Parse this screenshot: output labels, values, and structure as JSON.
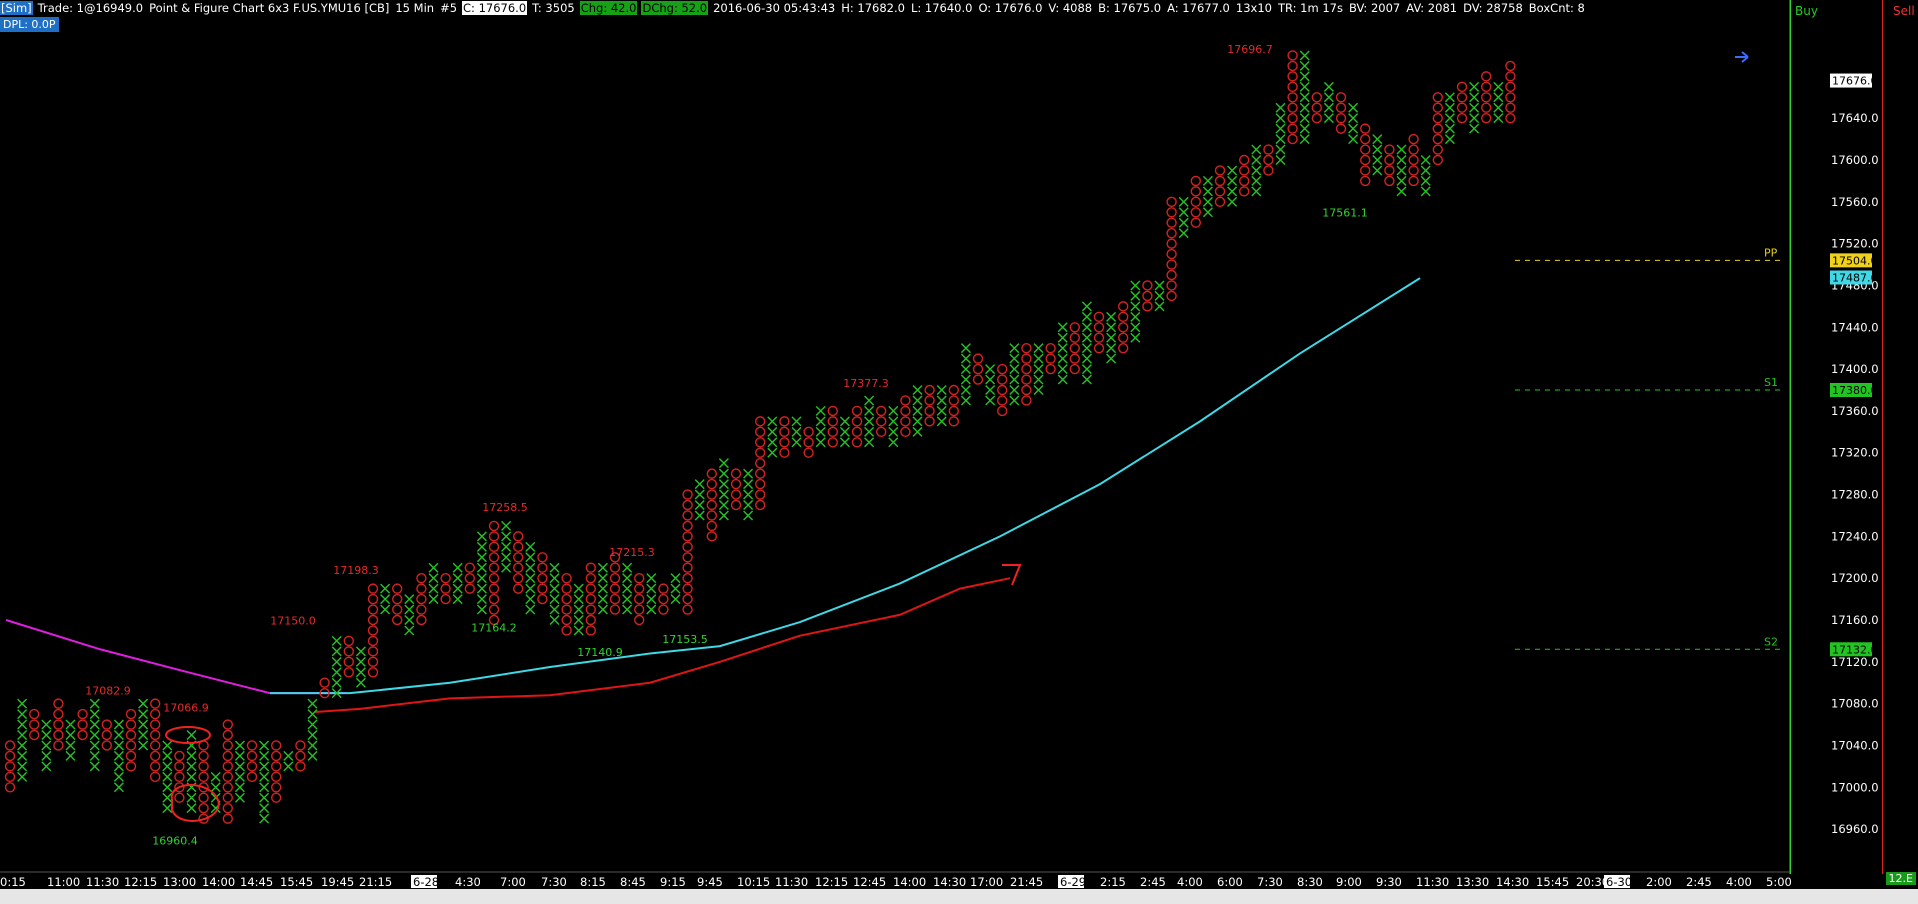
{
  "header": {
    "sim": "[Sim]",
    "trade": "Trade: 1@16949.0",
    "title": "Point & Figure Chart 6x3 F.US.YMU16 [CB]",
    "interval": "15 Min",
    "count": "#5",
    "close": "C: 17676.0",
    "ticks": "T: 3505",
    "chg": "Chg: 42.0",
    "dchg": "DChg: 52.0",
    "timestamp": "2016-06-30 05:43:43",
    "high": "H: 17682.0",
    "low": "L: 17640.0",
    "open": "O: 17676.0",
    "volume": "V: 4088",
    "bid": "B: 17675.0",
    "ask": "A: 17677.0",
    "size": "13x10",
    "tr": "TR: 1m 17s",
    "bv": "BV: 2007",
    "av": "AV: 2081",
    "dv": "DV: 28758",
    "boxcnt": "BoxCnt: 8"
  },
  "dpl": "DPL: 0.0P",
  "panels": {
    "buy": "Buy",
    "sell": "Sell",
    "corner_price": "12.E"
  },
  "colors": {
    "x_color": "#27c227",
    "o_color": "#d52222",
    "ma_cyan": "#3fd8e6",
    "ma_magenta": "#e01ee0",
    "pp_yellow": "#e6d019",
    "level_green": "#22c422"
  },
  "chart_data": {
    "type": "point-and-figure",
    "ylim": [
      16940,
      17710
    ],
    "y_ticks": [
      16960,
      17000,
      17040,
      17080,
      17120,
      17160,
      17200,
      17240,
      17280,
      17320,
      17360,
      17400,
      17440,
      17480,
      17520,
      17560,
      17600,
      17640
    ],
    "x_tick_labels": [
      "0:15",
      "11:00",
      "11:30",
      "12:15",
      "13:00",
      "14:00",
      "14:45",
      "15:45",
      "19:45",
      "21:15",
      "6-28",
      "4:30",
      "7:00",
      "7:30",
      "8:15",
      "8:45",
      "9:15",
      "9:45",
      "10:15",
      "11:30",
      "12:15",
      "12:45",
      "14:00",
      "14:30",
      "17:00",
      "21:45",
      "6-29",
      "2:15",
      "2:45",
      "4:00",
      "6:00",
      "7:30",
      "8:30",
      "9:00",
      "9:30",
      "11:30",
      "13:30",
      "14:30",
      "15:45",
      "20:30",
      "6-30",
      "2:00",
      "2:45",
      "4:00",
      "5:00"
    ],
    "column_ranges": [
      [
        17000,
        17040
      ],
      [
        17010,
        17080
      ],
      [
        17050,
        17070
      ],
      [
        17020,
        17060
      ],
      [
        17040,
        17080
      ],
      [
        17030,
        17060
      ],
      [
        17050,
        17070
      ],
      [
        17020,
        17080
      ],
      [
        17040,
        17060
      ],
      [
        17000,
        17060
      ],
      [
        17020,
        17070
      ],
      [
        17040,
        17080
      ],
      [
        17010,
        17080
      ],
      [
        16980,
        17040
      ],
      [
        16990,
        17030
      ],
      [
        16980,
        17050
      ],
      [
        16970,
        17040
      ],
      [
        16980,
        17010
      ],
      [
        16970,
        17060
      ],
      [
        16990,
        17040
      ],
      [
        17010,
        17040
      ],
      [
        16970,
        17040
      ],
      [
        16990,
        17040
      ],
      [
        17020,
        17030
      ],
      [
        17020,
        17040
      ],
      [
        17030,
        17080
      ],
      [
        17090,
        17100
      ],
      [
        17090,
        17140
      ],
      [
        17110,
        17140
      ],
      [
        17100,
        17130
      ],
      [
        17110,
        17190
      ],
      [
        17170,
        17190
      ],
      [
        17160,
        17190
      ],
      [
        17150,
        17180
      ],
      [
        17160,
        17200
      ],
      [
        17180,
        17210
      ],
      [
        17180,
        17200
      ],
      [
        17180,
        17210
      ],
      [
        17190,
        17210
      ],
      [
        17170,
        17240
      ],
      [
        17160,
        17250
      ],
      [
        17210,
        17250
      ],
      [
        17190,
        17240
      ],
      [
        17170,
        17230
      ],
      [
        17180,
        17220
      ],
      [
        17160,
        17210
      ],
      [
        17150,
        17200
      ],
      [
        17150,
        17190
      ],
      [
        17150,
        17210
      ],
      [
        17170,
        17210
      ],
      [
        17170,
        17220
      ],
      [
        17170,
        17210
      ],
      [
        17160,
        17200
      ],
      [
        17170,
        17200
      ],
      [
        17170,
        17190
      ],
      [
        17180,
        17200
      ],
      [
        17170,
        17280
      ],
      [
        17260,
        17290
      ],
      [
        17240,
        17300
      ],
      [
        17260,
        17310
      ],
      [
        17270,
        17300
      ],
      [
        17260,
        17300
      ],
      [
        17270,
        17350
      ],
      [
        17320,
        17350
      ],
      [
        17320,
        17350
      ],
      [
        17330,
        17350
      ],
      [
        17320,
        17340
      ],
      [
        17330,
        17360
      ],
      [
        17330,
        17360
      ],
      [
        17330,
        17350
      ],
      [
        17330,
        17360
      ],
      [
        17330,
        17370
      ],
      [
        17340,
        17360
      ],
      [
        17330,
        17360
      ],
      [
        17340,
        17370
      ],
      [
        17340,
        17380
      ],
      [
        17350,
        17380
      ],
      [
        17350,
        17380
      ],
      [
        17350,
        17380
      ],
      [
        17370,
        17420
      ],
      [
        17390,
        17410
      ],
      [
        17370,
        17400
      ],
      [
        17360,
        17400
      ],
      [
        17370,
        17420
      ],
      [
        17370,
        17420
      ],
      [
        17380,
        17420
      ],
      [
        17400,
        17420
      ],
      [
        17390,
        17440
      ],
      [
        17400,
        17440
      ],
      [
        17390,
        17460
      ],
      [
        17420,
        17450
      ],
      [
        17410,
        17450
      ],
      [
        17420,
        17460
      ],
      [
        17430,
        17480
      ],
      [
        17460,
        17480
      ],
      [
        17460,
        17480
      ],
      [
        17470,
        17560
      ],
      [
        17530,
        17560
      ],
      [
        17540,
        17580
      ],
      [
        17550,
        17580
      ],
      [
        17560,
        17590
      ],
      [
        17560,
        17590
      ],
      [
        17570,
        17600
      ],
      [
        17570,
        17610
      ],
      [
        17590,
        17610
      ],
      [
        17600,
        17650
      ],
      [
        17620,
        17700
      ],
      [
        17620,
        17700
      ],
      [
        17640,
        17660
      ],
      [
        17640,
        17670
      ],
      [
        17630,
        17660
      ],
      [
        17620,
        17650
      ],
      [
        17580,
        17630
      ],
      [
        17590,
        17620
      ],
      [
        17580,
        17610
      ],
      [
        17570,
        17610
      ],
      [
        17580,
        17620
      ],
      [
        17570,
        17600
      ],
      [
        17600,
        17660
      ],
      [
        17620,
        17660
      ],
      [
        17640,
        17670
      ],
      [
        17630,
        17670
      ],
      [
        17640,
        17680
      ],
      [
        17640,
        17670
      ],
      [
        17640,
        17690
      ]
    ],
    "annotations_red": [
      {
        "text": "17082.9",
        "x": 108,
        "y": 17082.9
      },
      {
        "text": "17066.9",
        "x": 186,
        "y": 17066.9
      },
      {
        "text": "17150.0",
        "x": 293,
        "y": 17150
      },
      {
        "text": "17198.3",
        "x": 356,
        "y": 17198.3
      },
      {
        "text": "17258.5",
        "x": 505,
        "y": 17258.5
      },
      {
        "text": "17215.3",
        "x": 632,
        "y": 17215.3
      },
      {
        "text": "17377.3",
        "x": 866,
        "y": 17377.3
      },
      {
        "text": "17696.7",
        "x": 1250,
        "y": 17696.7
      }
    ],
    "annotations_green": [
      {
        "text": "16960.4",
        "x": 175,
        "y": 16960.4
      },
      {
        "text": "17164.2",
        "x": 494,
        "y": 17164.2
      },
      {
        "text": "17140.9",
        "x": 600,
        "y": 17140.9
      },
      {
        "text": "17153.5",
        "x": 685,
        "y": 17153.5
      },
      {
        "text": "17561.1",
        "x": 1345,
        "y": 17561.1
      }
    ],
    "levels": [
      {
        "name": "PP",
        "value": 17504.0,
        "color": "#e6d019"
      },
      {
        "name": "S1",
        "value": 17380.0,
        "color": "#22c422"
      },
      {
        "name": "S2",
        "value": 17132.0,
        "color": "#22c422"
      }
    ],
    "axis_tags": [
      {
        "text": "17676.0",
        "value": 17676,
        "bg": "#ffffff",
        "fg": "#000000"
      },
      {
        "text": "17504.0",
        "value": 17504,
        "bg": "#f0d21a",
        "fg": "#000000"
      },
      {
        "text": "17487.6",
        "value": 17487.6,
        "bg": "#3fd8e6",
        "fg": "#000000"
      },
      {
        "text": "17380.0",
        "value": 17380,
        "bg": "#22c422",
        "fg": "#000000"
      },
      {
        "text": "17132.0",
        "value": 17132,
        "bg": "#22c422",
        "fg": "#000000"
      }
    ],
    "ma_cyan": [
      [
        270,
        17090
      ],
      [
        350,
        17090
      ],
      [
        450,
        17100
      ],
      [
        550,
        17115
      ],
      [
        650,
        17128
      ],
      [
        720,
        17135
      ],
      [
        800,
        17158
      ],
      [
        900,
        17195
      ],
      [
        1000,
        17240
      ],
      [
        1100,
        17290
      ],
      [
        1200,
        17350
      ],
      [
        1300,
        17415
      ],
      [
        1420,
        17487
      ]
    ],
    "ma_magenta": [
      [
        6,
        17160
      ],
      [
        100,
        17132
      ],
      [
        180,
        17112
      ],
      [
        270,
        17090
      ],
      [
        345,
        17090
      ]
    ],
    "drawn_line": [
      [
        315,
        17072
      ],
      [
        360,
        17075
      ],
      [
        450,
        17085
      ],
      [
        550,
        17088
      ],
      [
        650,
        17100
      ],
      [
        720,
        17120
      ],
      [
        800,
        17145
      ],
      [
        900,
        17165
      ],
      [
        960,
        17190
      ],
      [
        1010,
        17200
      ]
    ]
  }
}
